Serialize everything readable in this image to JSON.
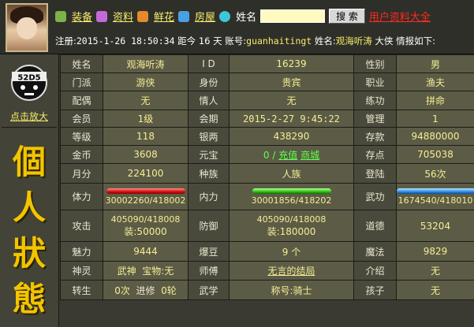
{
  "nav": {
    "items": [
      "装备",
      "资料",
      "鲜花",
      "房屋"
    ],
    "search_label": "姓名",
    "search_value": "",
    "search_button": "搜 索",
    "user_list_link": "用户资料大全"
  },
  "info": {
    "register_label": "注册:",
    "register_date": "2015-1-26 18:50:34",
    "since_label": "距今",
    "since_value": "16 天",
    "account_label": "账号:",
    "account": "guanhaitingt",
    "name_label": "姓名:",
    "name": "观海听涛",
    "title": "大侠",
    "suffix": "情报如下:"
  },
  "side": {
    "badge_text": "52D5",
    "zoom_link": "点击放大",
    "vertical_title": [
      "個",
      "人",
      "狀",
      "態"
    ]
  },
  "stats": {
    "r1": {
      "k1": "姓名",
      "v1": "观海听涛",
      "k2": "I D",
      "v2": "16239",
      "k3": "性别",
      "v3": "男"
    },
    "r2": {
      "k1": "门派",
      "v1": "游侠",
      "k2": "身份",
      "v2": "贵宾",
      "k3": "职业",
      "v3": "渔夫"
    },
    "r3": {
      "k1": "配偶",
      "v1": "无",
      "k2": "情人",
      "v2": "无",
      "k3": "练功",
      "v3": "拼命"
    },
    "r4": {
      "k1": "会员",
      "v1": "1级",
      "k2": "会期",
      "v2": "2015-2-27 9:45:22",
      "k3": "管理",
      "v3": "1"
    },
    "r5": {
      "k1": "等级",
      "v1": "118",
      "k2": "银两",
      "v2": "438290",
      "k3": "存款",
      "v3": "94880000"
    },
    "r6": {
      "k1": "金币",
      "v1": "3608",
      "k2": "元宝",
      "v2a": "0 /",
      "v2b": "充值",
      "v2c": "商城",
      "k3": "存点",
      "v3": "705038"
    },
    "r7": {
      "k1": "月分",
      "v1": "224100",
      "k2": "种族",
      "v2": "人族",
      "k3": "登陆",
      "v3": "56次"
    },
    "r8": {
      "k1": "体力",
      "v1": "30002260/418002",
      "k2": "内力",
      "v2": "30001856/418202",
      "k3": "武功",
      "v3": "1674540/418010"
    },
    "r9": {
      "k1": "攻击",
      "v1a": "405090/418008",
      "v1b": "装:50000",
      "k2": "防御",
      "v2a": "405090/418008",
      "v2b": "装:180000",
      "k3": "道德",
      "v3": "53204"
    },
    "r10": {
      "k1": "魅力",
      "v1": "9444",
      "k2": "爆豆",
      "v2": "9 个",
      "k3": "魔法",
      "v3": "9829"
    },
    "r11": {
      "k1": "神灵",
      "v1a": "武神",
      "v1b": "宝物:无",
      "k2": "师傅",
      "v2": "无言的结局",
      "k3": "介绍",
      "v3": "无"
    },
    "r12": {
      "k1": "转生",
      "v1a": "0次",
      "v1b": "进修",
      "v1c": "0轮",
      "k2": "武学",
      "v2": "称号:骑士",
      "k3": "孩子",
      "v3": "无"
    }
  },
  "colors": {
    "accent": "#f6ec6a",
    "link_red": "#ff2a1f",
    "green": "#5eff4a",
    "title_gold": "#f3c400"
  }
}
